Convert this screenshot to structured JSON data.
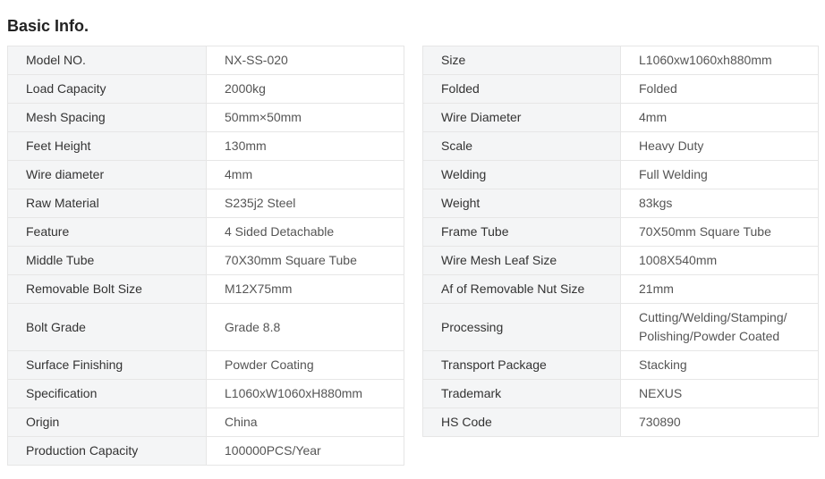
{
  "title": "Basic Info.",
  "left_table": [
    {
      "key": "Model NO.",
      "value": "NX-SS-020"
    },
    {
      "key": "Load Capacity",
      "value": "2000kg"
    },
    {
      "key": "Mesh Spacing",
      "value": "50mm×50mm"
    },
    {
      "key": "Feet Height",
      "value": "130mm"
    },
    {
      "key": "Wire diameter",
      "value": "4mm"
    },
    {
      "key": "Raw Material",
      "value": "S235j2 Steel"
    },
    {
      "key": "Feature",
      "value": "4 Sided Detachable"
    },
    {
      "key": "Middle Tube",
      "value": "70X30mm Square Tube"
    },
    {
      "key": "Removable Bolt Size",
      "value": "M12X75mm"
    },
    {
      "key": "Bolt Grade",
      "value": "Grade 8.8"
    },
    {
      "key": "Surface Finishing",
      "value": "Powder Coating"
    },
    {
      "key": "Specification",
      "value": "L1060xW1060xH880mm"
    },
    {
      "key": "Origin",
      "value": "China"
    },
    {
      "key": "Production Capacity",
      "value": "100000PCS/Year"
    }
  ],
  "right_table": [
    {
      "key": "Size",
      "value": "L1060xw1060xh880mm"
    },
    {
      "key": "Folded",
      "value": "Folded"
    },
    {
      "key": "Wire Diameter",
      "value": "4mm"
    },
    {
      "key": "Scale",
      "value": "Heavy Duty"
    },
    {
      "key": "Welding",
      "value": "Full Welding"
    },
    {
      "key": "Weight",
      "value": "83kgs"
    },
    {
      "key": "Frame Tube",
      "value": "70X50mm Square Tube"
    },
    {
      "key": "Wire Mesh Leaf Size",
      "value": "1008X540mm"
    },
    {
      "key": "Af of Removable Nut Size",
      "value": "21mm"
    },
    {
      "key": "Processing",
      "value": "Cutting/Welding/Stamping/ Polishing/Powder Coated"
    },
    {
      "key": "Transport Package",
      "value": "Stacking"
    },
    {
      "key": "Trademark",
      "value": "NEXUS"
    },
    {
      "key": "HS Code",
      "value": "730890"
    }
  ]
}
